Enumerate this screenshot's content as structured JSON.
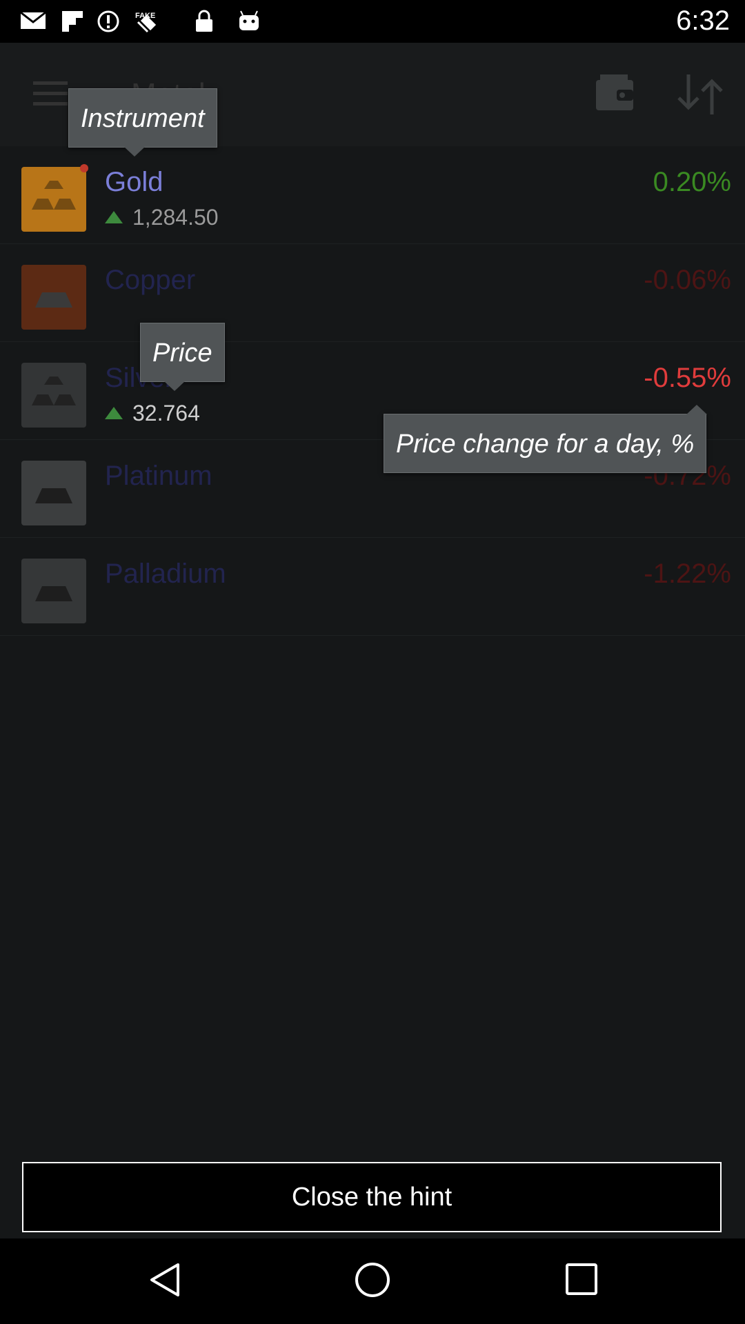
{
  "status_bar": {
    "time": "6:32",
    "icons": [
      "mail-icon",
      "flipboard-icon",
      "alert-icon",
      "satellite-icon",
      "lock-icon",
      "android-icon"
    ]
  },
  "app_bar": {
    "title": "Metal",
    "icons": [
      "menu-icon",
      "wallet-icon",
      "sort-icon"
    ]
  },
  "instruments": [
    {
      "name": "Gold",
      "price": "1,284.50",
      "change": "0.20%",
      "direction": "up",
      "color": "#d4922a",
      "bars": "stack"
    },
    {
      "name": "Copper",
      "price": "",
      "change": "-0.06%",
      "direction": "down",
      "color": "#d66a3a",
      "bars": "single"
    },
    {
      "name": "Silver",
      "price": "32.764",
      "change": "-0.55%",
      "direction": "down",
      "color": "#9a9a9a",
      "bars": "stack"
    },
    {
      "name": "Platinum",
      "price": "",
      "change": "-0.72%",
      "direction": "down",
      "color": "#bdbdbd",
      "bars": "single"
    },
    {
      "name": "Palladium",
      "price": "",
      "change": "-1.22%",
      "direction": "down",
      "color": "#a9a9a9",
      "bars": "single"
    }
  ],
  "hints": {
    "instrument": "Instrument",
    "price": "Price",
    "change": "Price change for a day, %"
  },
  "close_hint_label": "Close the hint",
  "nav_bar": {
    "icons": [
      "back-icon",
      "home-icon",
      "recents-icon"
    ]
  }
}
